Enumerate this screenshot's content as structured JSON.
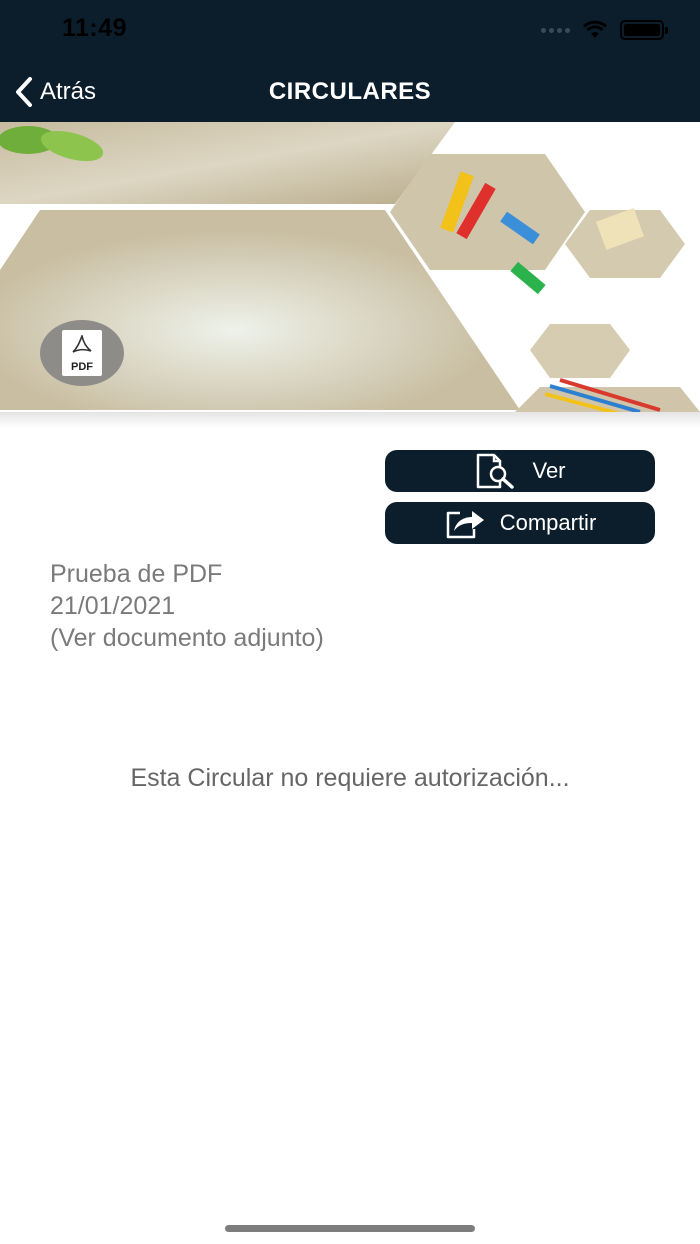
{
  "status_bar": {
    "time": "11:49"
  },
  "nav": {
    "back_label": "Atrás",
    "title": "CIRCULARES"
  },
  "banner": {
    "badge_label": "PDF"
  },
  "actions": {
    "view_label": "Ver",
    "share_label": "Compartir"
  },
  "circular": {
    "title": "Prueba de PDF",
    "date": "21/01/2021",
    "attachment_note": "(Ver documento adjunto)"
  },
  "authorization_note": "Esta Circular no requiere autorización...",
  "colors": {
    "nav_bg": "#0c1e2c",
    "button_bg": "#0c1e2c",
    "text_muted": "#7a7a7a"
  }
}
